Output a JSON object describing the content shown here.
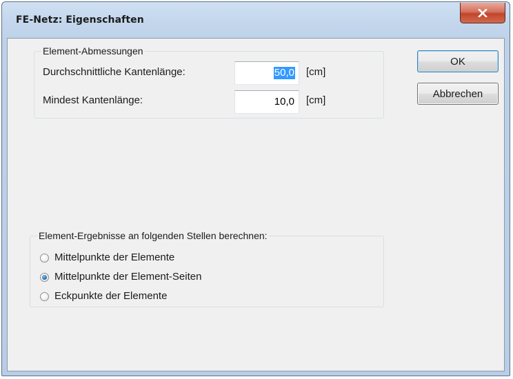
{
  "window": {
    "title": "FE-Netz: Eigenschaften",
    "close_icon": "close-x-icon"
  },
  "dimensions_group": {
    "label": "Element-Abmessungen",
    "rows": [
      {
        "label": "Durchschnittliche Kantenlänge:",
        "value": "50,0",
        "unit": "[cm]",
        "selected": true
      },
      {
        "label": "Mindest Kantenlänge:",
        "value": "10,0",
        "unit": "[cm]",
        "selected": false
      }
    ]
  },
  "buttons": {
    "ok": "OK",
    "cancel": "Abbrechen"
  },
  "results_group": {
    "label": "Element-Ergebnisse an folgenden Stellen berechnen:",
    "options": [
      {
        "label": "Mittelpunkte der Elemente",
        "checked": false
      },
      {
        "label": "Mittelpunkte der Element-Seiten",
        "checked": true
      },
      {
        "label": "Eckpunkte der Elemente",
        "checked": false
      }
    ]
  },
  "colors": {
    "selection": "#3399ff",
    "close_button": "#c2452b",
    "client_background": "#f0f0f0"
  }
}
